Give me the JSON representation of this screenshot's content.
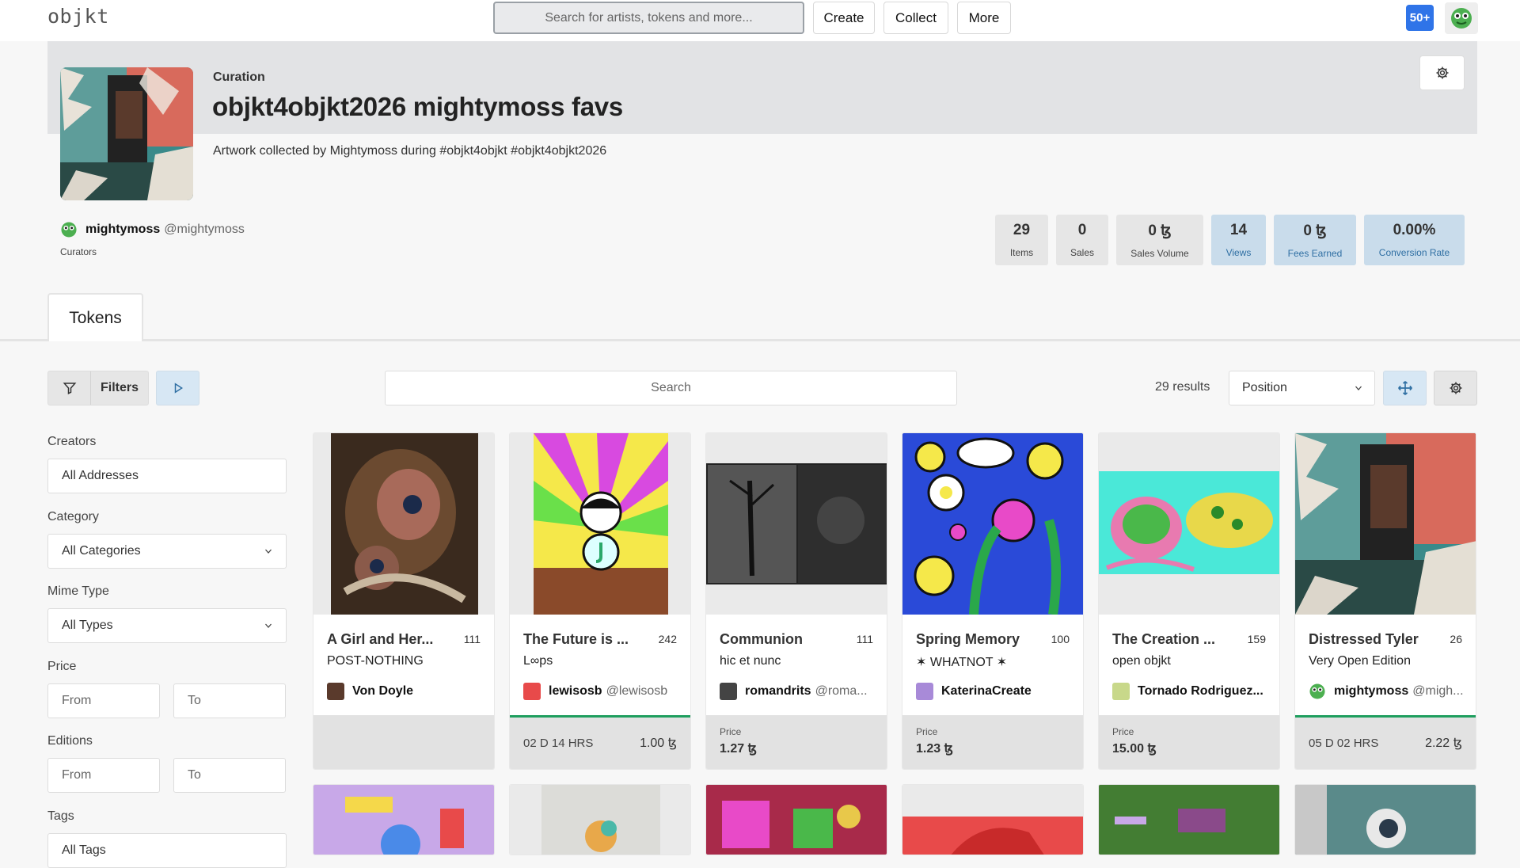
{
  "topbar": {
    "logo": "objkt",
    "search_placeholder": "Search for artists, tokens and more...",
    "nav": [
      "Create",
      "Collect",
      "More"
    ],
    "notification_badge": "50+"
  },
  "header": {
    "eyebrow": "Curation",
    "title": "objkt4objkt2026 mightymoss favs",
    "description": "Artwork collected by Mightymoss during #objkt4objkt #objkt4objkt2026",
    "curator_name": "mightymoss",
    "curator_handle": "@mightymoss",
    "curators_label": "Curators"
  },
  "stats": [
    {
      "value": "29",
      "label": "Items"
    },
    {
      "value": "0",
      "label": "Sales"
    },
    {
      "value": "0 ꜩ",
      "label": "Sales Volume"
    },
    {
      "value": "14",
      "label": "Views"
    },
    {
      "value": "0 ꜩ",
      "label": "Fees Earned"
    },
    {
      "value": "0.00%",
      "label": "Conversion Rate"
    }
  ],
  "tabs": {
    "tokens": "Tokens"
  },
  "toolbar": {
    "filters_label": "Filters",
    "search_placeholder": "Search",
    "results": "29 results",
    "sort": "Position"
  },
  "sidebar": {
    "creators_label": "Creators",
    "creators_value": "All Addresses",
    "category_label": "Category",
    "category_value": "All Categories",
    "mime_label": "Mime Type",
    "mime_value": "All Types",
    "price_label": "Price",
    "price_from": "From",
    "price_to": "To",
    "editions_label": "Editions",
    "editions_from": "From",
    "editions_to": "To",
    "tags_label": "Tags",
    "tags_value": "All Tags"
  },
  "cards": [
    {
      "title": "A Girl and Her...",
      "editions": "111",
      "collection": "POST-NOTHING",
      "creator": "Von Doyle",
      "handle": "",
      "price_label": "",
      "price": "",
      "countdown": "",
      "amount": ""
    },
    {
      "title": "The Future is ...",
      "editions": "242",
      "collection": "L∞ps",
      "creator": "lewisosb",
      "handle": "@lewisosb",
      "price_label": "",
      "price": "",
      "countdown": "02 D  14 HRS",
      "amount": "1.00 ꜩ"
    },
    {
      "title": "Communion",
      "editions": "111",
      "collection": "hic et nunc",
      "creator": "romandrits",
      "handle": "@roma...",
      "price_label": "Price",
      "price": "1.27 ꜩ",
      "countdown": "",
      "amount": ""
    },
    {
      "title": "Spring Memory",
      "editions": "100",
      "collection": "✶ WHATNOT ✶",
      "creator": "KaterinaCreate",
      "handle": "",
      "price_label": "Price",
      "price": "1.23 ꜩ",
      "countdown": "",
      "amount": ""
    },
    {
      "title": "The Creation ...",
      "editions": "159",
      "collection": "open objkt",
      "creator": "Tornado Rodriguez...",
      "handle": "",
      "price_label": "Price",
      "price": "15.00 ꜩ",
      "countdown": "",
      "amount": ""
    },
    {
      "title": "Distressed Tyler",
      "editions": "26",
      "collection": "Very Open Edition",
      "creator": "mightymoss",
      "handle": "@migh...",
      "price_label": "",
      "price": "",
      "countdown": "05 D  02 HRS",
      "amount": "2.22 ꜩ"
    }
  ],
  "colors": {
    "accent": "#2f74e8",
    "active_bar": "#1e9e5e",
    "stat_highlight": "#c9dceb"
  }
}
